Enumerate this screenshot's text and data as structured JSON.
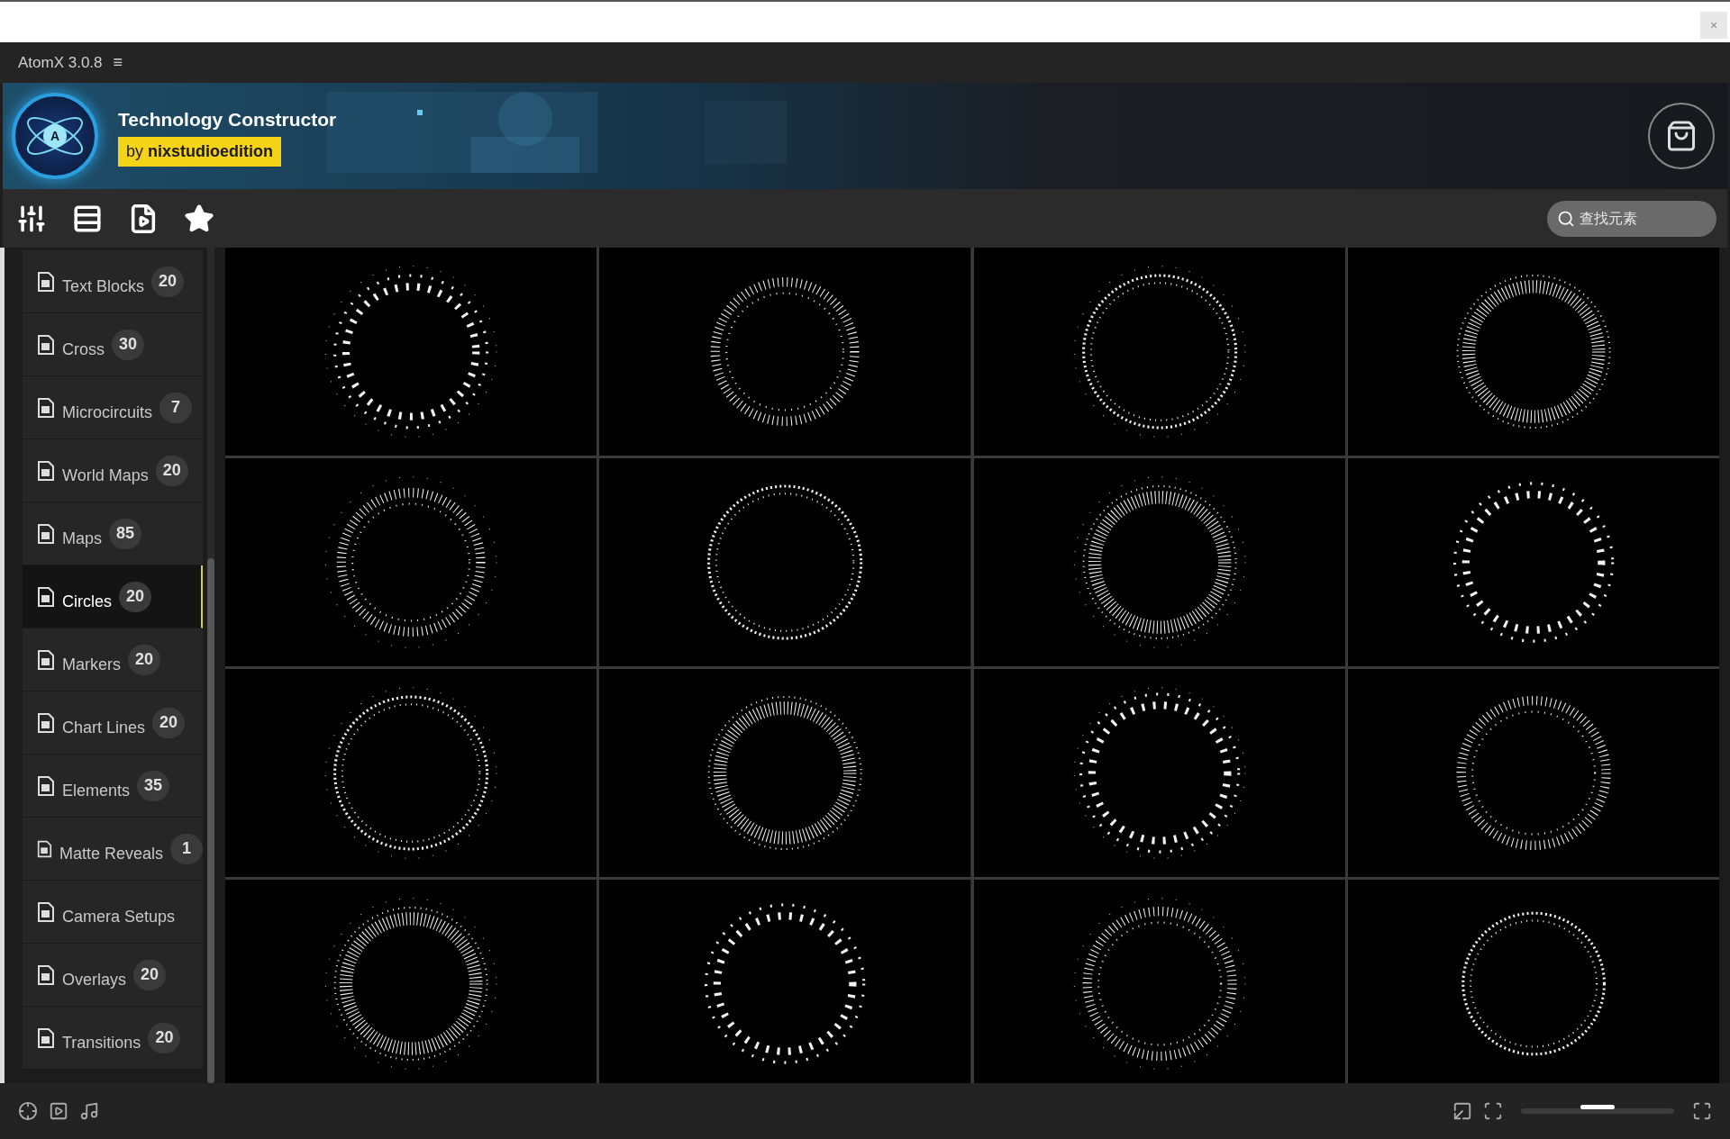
{
  "top_strip": {
    "close": "×"
  },
  "window": {
    "title": "AtomX 3.0.8",
    "menu": "≡"
  },
  "banner": {
    "logo_letter": "A",
    "title": "Technology Constructor",
    "byline": "by **nixstudioedition**"
  },
  "toolbar": {
    "search": {
      "placeholder": "查找元素"
    }
  },
  "sidebar": {
    "items": [
      {
        "label": "Text Blocks",
        "count": "20",
        "selected": false
      },
      {
        "label": "Cross",
        "count": "30",
        "selected": false
      },
      {
        "label": "Microcircuits",
        "count": "7",
        "selected": false
      },
      {
        "label": "World Maps",
        "count": "20",
        "selected": false
      },
      {
        "label": "Maps",
        "count": "85",
        "selected": false
      },
      {
        "label": "Circles",
        "count": "20",
        "selected": true
      },
      {
        "label": "Markers",
        "count": "20",
        "selected": false
      },
      {
        "label": "Chart Lines",
        "count": "20",
        "selected": false
      },
      {
        "label": "Elements",
        "count": "35",
        "selected": false
      },
      {
        "label": "Matte Reveals",
        "count": "1",
        "selected": false
      },
      {
        "label": "Camera Setups",
        "selected": false
      },
      {
        "label": "Overlays",
        "count": "20",
        "selected": false
      },
      {
        "label": "Transitions",
        "count": "20",
        "selected": false
      }
    ]
  },
  "bottom_bar": {
    "zoom": {
      "level": 0.5
    }
  }
}
